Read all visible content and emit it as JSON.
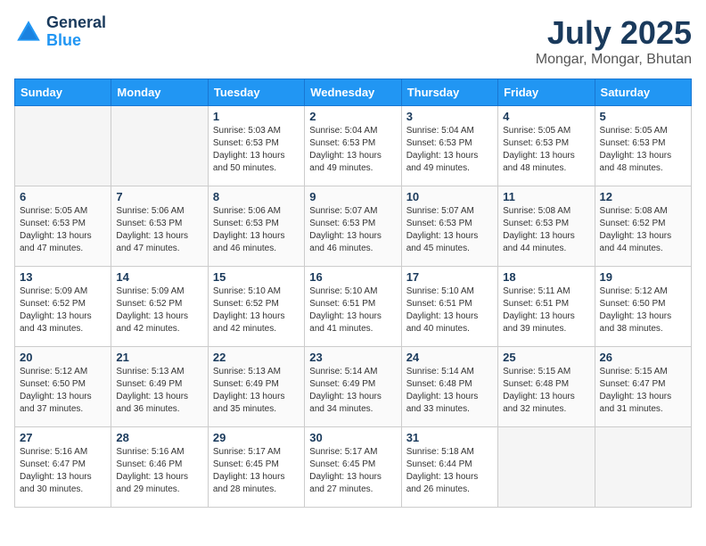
{
  "header": {
    "logo_line1": "General",
    "logo_line2": "Blue",
    "month": "July 2025",
    "location": "Mongar, Mongar, Bhutan"
  },
  "weekdays": [
    "Sunday",
    "Monday",
    "Tuesday",
    "Wednesday",
    "Thursday",
    "Friday",
    "Saturday"
  ],
  "weeks": [
    [
      {
        "day": "",
        "info": ""
      },
      {
        "day": "",
        "info": ""
      },
      {
        "day": "1",
        "info": "Sunrise: 5:03 AM\nSunset: 6:53 PM\nDaylight: 13 hours\nand 50 minutes."
      },
      {
        "day": "2",
        "info": "Sunrise: 5:04 AM\nSunset: 6:53 PM\nDaylight: 13 hours\nand 49 minutes."
      },
      {
        "day": "3",
        "info": "Sunrise: 5:04 AM\nSunset: 6:53 PM\nDaylight: 13 hours\nand 49 minutes."
      },
      {
        "day": "4",
        "info": "Sunrise: 5:05 AM\nSunset: 6:53 PM\nDaylight: 13 hours\nand 48 minutes."
      },
      {
        "day": "5",
        "info": "Sunrise: 5:05 AM\nSunset: 6:53 PM\nDaylight: 13 hours\nand 48 minutes."
      }
    ],
    [
      {
        "day": "6",
        "info": "Sunrise: 5:05 AM\nSunset: 6:53 PM\nDaylight: 13 hours\nand 47 minutes."
      },
      {
        "day": "7",
        "info": "Sunrise: 5:06 AM\nSunset: 6:53 PM\nDaylight: 13 hours\nand 47 minutes."
      },
      {
        "day": "8",
        "info": "Sunrise: 5:06 AM\nSunset: 6:53 PM\nDaylight: 13 hours\nand 46 minutes."
      },
      {
        "day": "9",
        "info": "Sunrise: 5:07 AM\nSunset: 6:53 PM\nDaylight: 13 hours\nand 46 minutes."
      },
      {
        "day": "10",
        "info": "Sunrise: 5:07 AM\nSunset: 6:53 PM\nDaylight: 13 hours\nand 45 minutes."
      },
      {
        "day": "11",
        "info": "Sunrise: 5:08 AM\nSunset: 6:53 PM\nDaylight: 13 hours\nand 44 minutes."
      },
      {
        "day": "12",
        "info": "Sunrise: 5:08 AM\nSunset: 6:52 PM\nDaylight: 13 hours\nand 44 minutes."
      }
    ],
    [
      {
        "day": "13",
        "info": "Sunrise: 5:09 AM\nSunset: 6:52 PM\nDaylight: 13 hours\nand 43 minutes."
      },
      {
        "day": "14",
        "info": "Sunrise: 5:09 AM\nSunset: 6:52 PM\nDaylight: 13 hours\nand 42 minutes."
      },
      {
        "day": "15",
        "info": "Sunrise: 5:10 AM\nSunset: 6:52 PM\nDaylight: 13 hours\nand 42 minutes."
      },
      {
        "day": "16",
        "info": "Sunrise: 5:10 AM\nSunset: 6:51 PM\nDaylight: 13 hours\nand 41 minutes."
      },
      {
        "day": "17",
        "info": "Sunrise: 5:10 AM\nSunset: 6:51 PM\nDaylight: 13 hours\nand 40 minutes."
      },
      {
        "day": "18",
        "info": "Sunrise: 5:11 AM\nSunset: 6:51 PM\nDaylight: 13 hours\nand 39 minutes."
      },
      {
        "day": "19",
        "info": "Sunrise: 5:12 AM\nSunset: 6:50 PM\nDaylight: 13 hours\nand 38 minutes."
      }
    ],
    [
      {
        "day": "20",
        "info": "Sunrise: 5:12 AM\nSunset: 6:50 PM\nDaylight: 13 hours\nand 37 minutes."
      },
      {
        "day": "21",
        "info": "Sunrise: 5:13 AM\nSunset: 6:49 PM\nDaylight: 13 hours\nand 36 minutes."
      },
      {
        "day": "22",
        "info": "Sunrise: 5:13 AM\nSunset: 6:49 PM\nDaylight: 13 hours\nand 35 minutes."
      },
      {
        "day": "23",
        "info": "Sunrise: 5:14 AM\nSunset: 6:49 PM\nDaylight: 13 hours\nand 34 minutes."
      },
      {
        "day": "24",
        "info": "Sunrise: 5:14 AM\nSunset: 6:48 PM\nDaylight: 13 hours\nand 33 minutes."
      },
      {
        "day": "25",
        "info": "Sunrise: 5:15 AM\nSunset: 6:48 PM\nDaylight: 13 hours\nand 32 minutes."
      },
      {
        "day": "26",
        "info": "Sunrise: 5:15 AM\nSunset: 6:47 PM\nDaylight: 13 hours\nand 31 minutes."
      }
    ],
    [
      {
        "day": "27",
        "info": "Sunrise: 5:16 AM\nSunset: 6:47 PM\nDaylight: 13 hours\nand 30 minutes."
      },
      {
        "day": "28",
        "info": "Sunrise: 5:16 AM\nSunset: 6:46 PM\nDaylight: 13 hours\nand 29 minutes."
      },
      {
        "day": "29",
        "info": "Sunrise: 5:17 AM\nSunset: 6:45 PM\nDaylight: 13 hours\nand 28 minutes."
      },
      {
        "day": "30",
        "info": "Sunrise: 5:17 AM\nSunset: 6:45 PM\nDaylight: 13 hours\nand 27 minutes."
      },
      {
        "day": "31",
        "info": "Sunrise: 5:18 AM\nSunset: 6:44 PM\nDaylight: 13 hours\nand 26 minutes."
      },
      {
        "day": "",
        "info": ""
      },
      {
        "day": "",
        "info": ""
      }
    ]
  ]
}
